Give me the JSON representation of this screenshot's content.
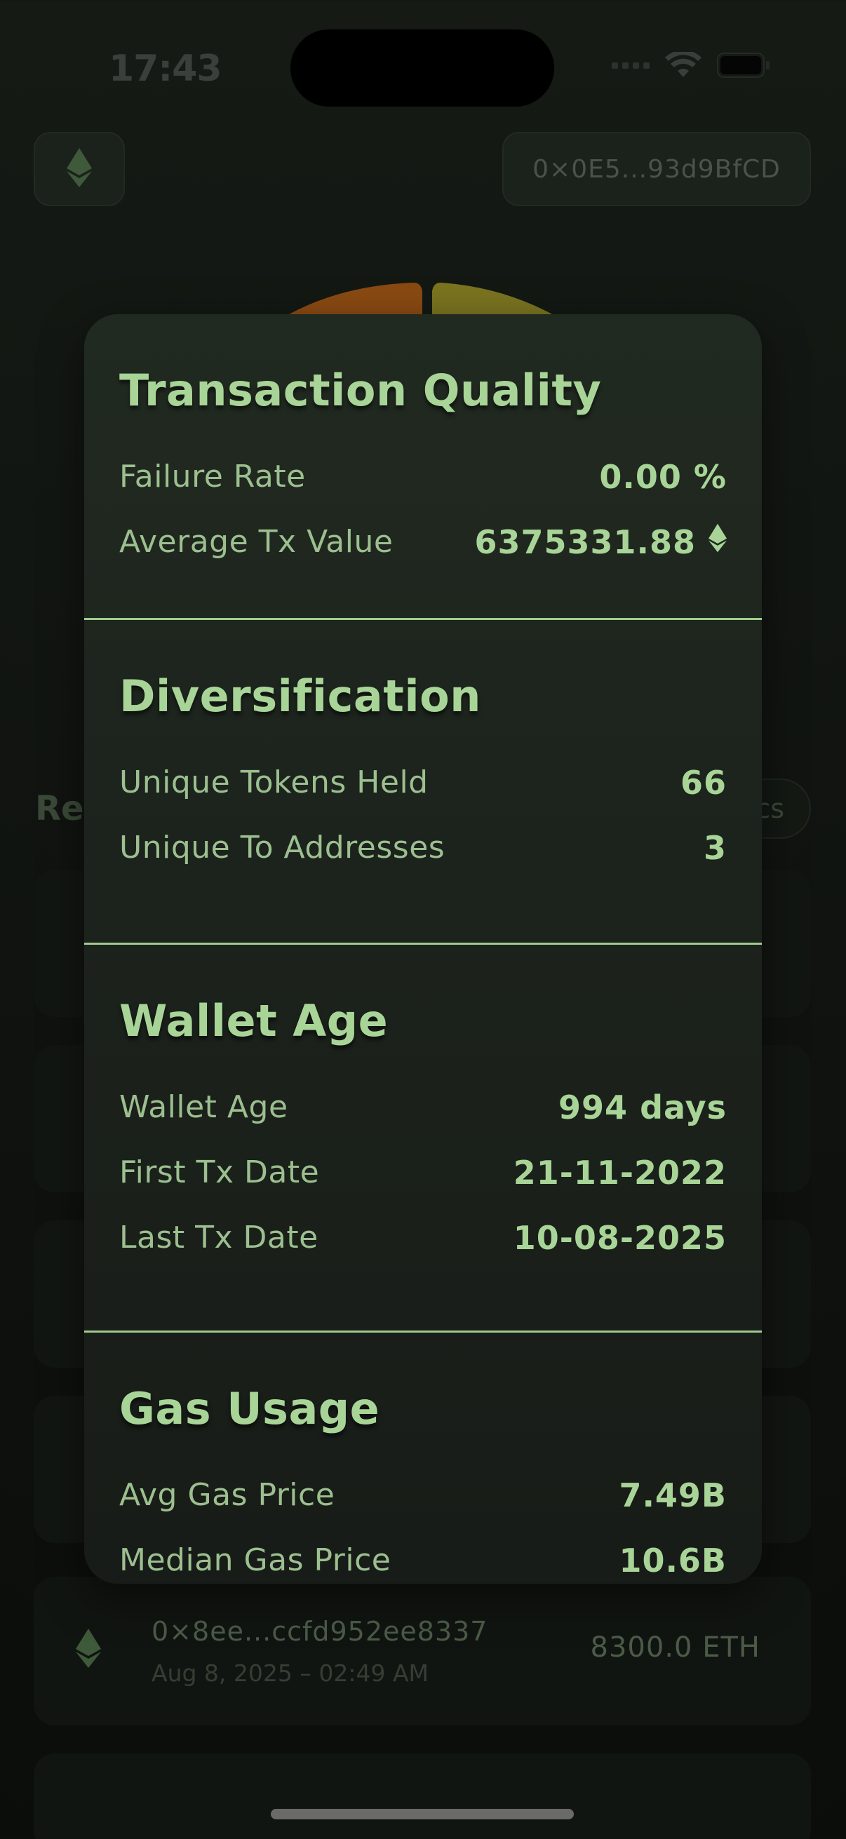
{
  "status_bar": {
    "time": "17:43"
  },
  "header": {
    "wallet_address": "0×0E5...93d9BfCD"
  },
  "background": {
    "section_title": "Re",
    "chip_label": "cs",
    "visible_transaction": {
      "address": "0×8ee...ccfd952ee8337",
      "date": "Aug 8, 2025 – 02:49 AM",
      "amount": "8300.0 ETH"
    }
  },
  "popover": {
    "transaction_quality": {
      "title": "Transaction Quality",
      "rows": [
        {
          "label": "Failure Rate",
          "value": "0.00 %"
        },
        {
          "label": "Average Tx Value",
          "value": "6375331.88"
        }
      ]
    },
    "diversification": {
      "title": "Diversification",
      "rows": [
        {
          "label": "Unique Tokens Held",
          "value": "66"
        },
        {
          "label": "Unique To Addresses",
          "value": "3"
        }
      ]
    },
    "wallet_age": {
      "title": "Wallet Age",
      "rows": [
        {
          "label": "Wallet Age",
          "value": "994 days"
        },
        {
          "label": "First Tx Date",
          "value": "21-11-2022"
        },
        {
          "label": "Last Tx Date",
          "value": "10-08-2025"
        }
      ]
    },
    "gas_usage": {
      "title": "Gas Usage",
      "rows": [
        {
          "label": "Avg Gas Price",
          "value": "7.49B"
        },
        {
          "label": "Median Gas Price",
          "value": "10.6B"
        }
      ]
    }
  },
  "icons": {
    "currency": "ethereum-icon",
    "status": [
      "signal-icon",
      "wifi-icon",
      "battery-icon"
    ]
  },
  "colors": {
    "accent_green": "#a8d597",
    "background": "#151a15",
    "card": "#212a21",
    "gauge_orange": "#8a4a12",
    "gauge_olive": "#7a7420"
  }
}
